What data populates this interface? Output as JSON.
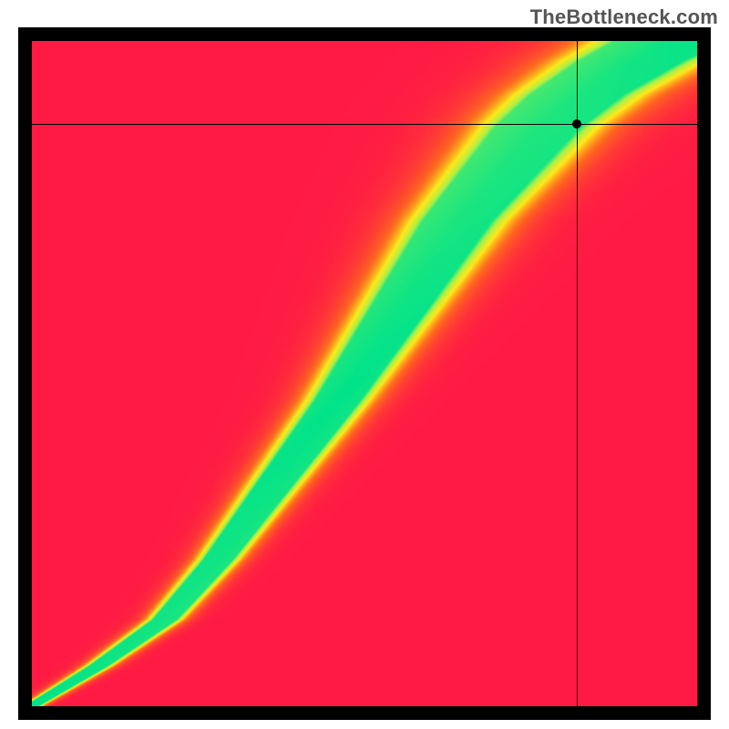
{
  "watermark": "TheBottleneck.com",
  "chart_data": {
    "type": "heatmap",
    "title": "",
    "xlabel": "",
    "ylabel": "",
    "xlim": [
      0,
      1
    ],
    "ylim": [
      0,
      1
    ],
    "crosshair": {
      "x": 0.82,
      "y": 0.875
    },
    "marker": {
      "x": 0.82,
      "y": 0.875
    },
    "ridge": [
      {
        "x": 0.0,
        "y": 0.0,
        "half_width": 0.01
      },
      {
        "x": 0.1,
        "y": 0.06,
        "half_width": 0.014
      },
      {
        "x": 0.2,
        "y": 0.13,
        "half_width": 0.018
      },
      {
        "x": 0.28,
        "y": 0.22,
        "half_width": 0.022
      },
      {
        "x": 0.34,
        "y": 0.3,
        "half_width": 0.026
      },
      {
        "x": 0.4,
        "y": 0.38,
        "half_width": 0.03
      },
      {
        "x": 0.46,
        "y": 0.46,
        "half_width": 0.034
      },
      {
        "x": 0.52,
        "y": 0.55,
        "half_width": 0.04
      },
      {
        "x": 0.58,
        "y": 0.64,
        "half_width": 0.046
      },
      {
        "x": 0.64,
        "y": 0.73,
        "half_width": 0.052
      },
      {
        "x": 0.7,
        "y": 0.8,
        "half_width": 0.058
      },
      {
        "x": 0.76,
        "y": 0.87,
        "half_width": 0.064
      },
      {
        "x": 0.82,
        "y": 0.92,
        "half_width": 0.07
      },
      {
        "x": 0.9,
        "y": 0.97,
        "half_width": 0.078
      },
      {
        "x": 1.0,
        "y": 1.02,
        "half_width": 0.088
      }
    ],
    "value_stops": [
      {
        "t": 0.0,
        "value": 0.0
      },
      {
        "t": 0.45,
        "value": 0.0
      },
      {
        "t": 1.0,
        "value": 1.0
      }
    ],
    "colormap": [
      {
        "t": 0.0,
        "color": "#ff1a44"
      },
      {
        "t": 0.25,
        "color": "#ff6a1f"
      },
      {
        "t": 0.5,
        "color": "#ffe81a"
      },
      {
        "t": 0.75,
        "color": "#a8f04a"
      },
      {
        "t": 1.0,
        "color": "#00e38a"
      }
    ],
    "description": "Heatmap showing bottleneck match quality over a 2D parameter space. A narrow diagonal ridge (green) marks near-optimal pairings; regions far from the ridge fade through yellow/orange to red. Black crosshair and dot mark the currently selected point."
  },
  "canvas_size": 730
}
